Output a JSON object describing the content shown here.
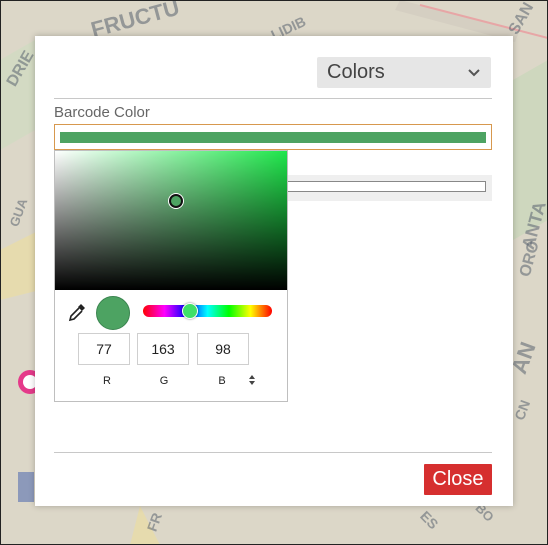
{
  "background_map": {
    "labels": [
      "FRUCTU",
      "LIDIB",
      "SAN",
      "DRIE",
      "ANTA",
      "ORO",
      "GUA",
      "AN",
      "CN",
      "FR",
      "ES",
      "BO"
    ]
  },
  "header": {
    "colors_select": {
      "value": "Colors",
      "icon": "chevron-down-icon"
    }
  },
  "barcode_color": {
    "label": "Barcode Color",
    "value_hex": "#4da362"
  },
  "color_picker": {
    "current_hex": "#4da362",
    "hue_hex": "#1fe64b",
    "hue_fraction": 0.36,
    "rgb": {
      "r": "77",
      "g": "163",
      "b": "98"
    },
    "labels": {
      "r": "R",
      "g": "G",
      "b": "B"
    },
    "mode_toggle_icon": "up-down-arrows-icon",
    "eyedropper_icon": "eyedropper-icon"
  },
  "footer": {
    "close_label": "Close",
    "close_color": "#d62f2f"
  }
}
